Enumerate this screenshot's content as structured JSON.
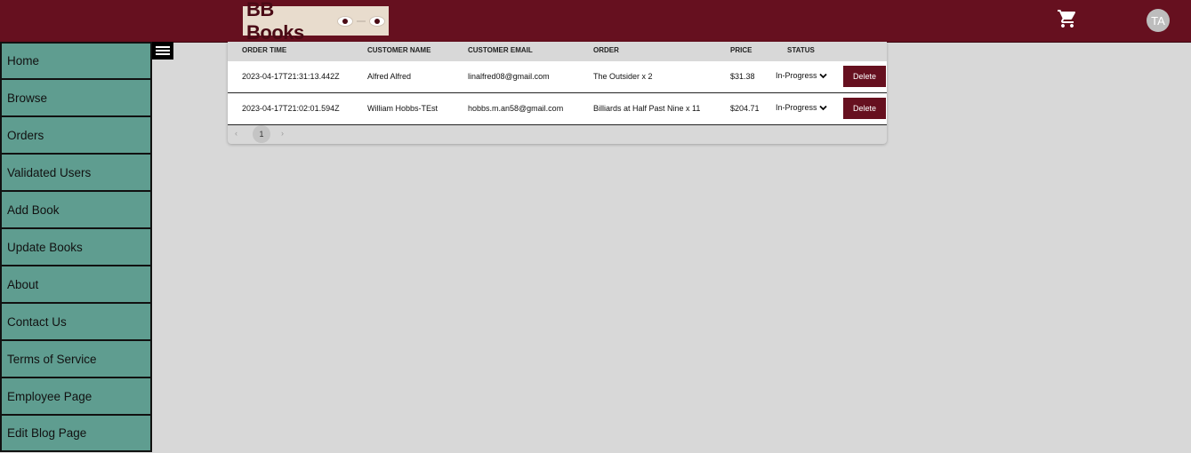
{
  "header": {
    "logo_text": "BB Books",
    "avatar_initials": "TA",
    "cart_icon": "shopping-cart-icon",
    "colors": {
      "brand": "#66101f",
      "sidebar": "#5f9d90",
      "background": "#d8d8d8"
    }
  },
  "sidebar": {
    "items": [
      {
        "label": "Home"
      },
      {
        "label": "Browse"
      },
      {
        "label": "Orders"
      },
      {
        "label": "Validated Users"
      },
      {
        "label": "Add Book"
      },
      {
        "label": "Update Books"
      },
      {
        "label": "About"
      },
      {
        "label": "Contact Us"
      },
      {
        "label": "Terms of Service"
      },
      {
        "label": "Employee Page"
      },
      {
        "label": "Edit Blog Page"
      }
    ]
  },
  "orders": {
    "columns": {
      "order_time": "ORDER TIME",
      "customer_name": "CUSTOMER NAME",
      "customer_email": "CUSTOMER EMAIL",
      "order": "ORDER",
      "price": "PRICE",
      "status": "STATUS"
    },
    "rows": [
      {
        "order_time": "2023-04-17T21:31:13.442Z",
        "customer_name": "Alfred Alfred",
        "customer_email": "linalfred08@gmail.com",
        "order": "The Outsider x 2",
        "price": "$31.38",
        "status": "In-Progress",
        "delete_label": "Delete"
      },
      {
        "order_time": "2023-04-17T21:02:01.594Z",
        "customer_name": "William Hobbs-TEst",
        "customer_email": "hobbs.m.an58@gmail.com",
        "order": "Billiards at Half Past Nine x 11",
        "price": "$204.71",
        "status": "In-Progress",
        "delete_label": "Delete"
      }
    ]
  },
  "pagination": {
    "prev": "‹",
    "current_page": "1",
    "next": "›"
  }
}
